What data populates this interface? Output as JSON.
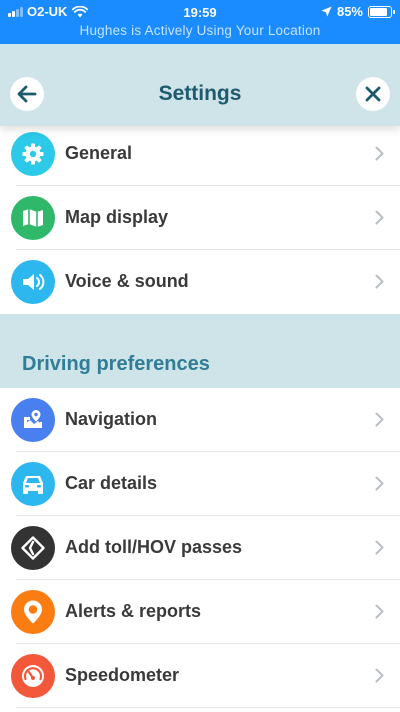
{
  "status_bar": {
    "carrier": "O2-UK",
    "time": "19:59",
    "battery": "85%",
    "battery_level": 0.85,
    "location_banner": "Hughes is Actively Using Your Location"
  },
  "header": {
    "title": "Settings",
    "back_icon": "arrow-left-icon",
    "close_icon": "close-icon"
  },
  "colors": {
    "status_bar": "#1a8cff",
    "header_bg": "#cfe4e9",
    "title": "#1d5a6d",
    "section_title": "#2f7d96"
  },
  "items": [
    {
      "label": "General",
      "icon": "gear-icon",
      "color": "#2cc9e8"
    },
    {
      "label": "Map display",
      "icon": "map-icon",
      "color": "#2fb86a"
    },
    {
      "label": "Voice & sound",
      "icon": "speaker-icon",
      "color": "#2cb8ee"
    }
  ],
  "driving_section": {
    "title": "Driving preferences",
    "items": [
      {
        "label": "Navigation",
        "icon": "navigation-map-pin-icon",
        "color": "#4a7ff0"
      },
      {
        "label": "Car details",
        "icon": "car-icon",
        "color": "#2cb8ee"
      },
      {
        "label": "Add toll/HOV passes",
        "icon": "toll-pass-diamond-icon",
        "color": "#333333"
      },
      {
        "label": "Alerts & reports",
        "icon": "alert-pin-icon",
        "color": "#fb7d12"
      },
      {
        "label": "Speedometer",
        "icon": "speedometer-icon",
        "color": "#f4583a"
      }
    ]
  }
}
